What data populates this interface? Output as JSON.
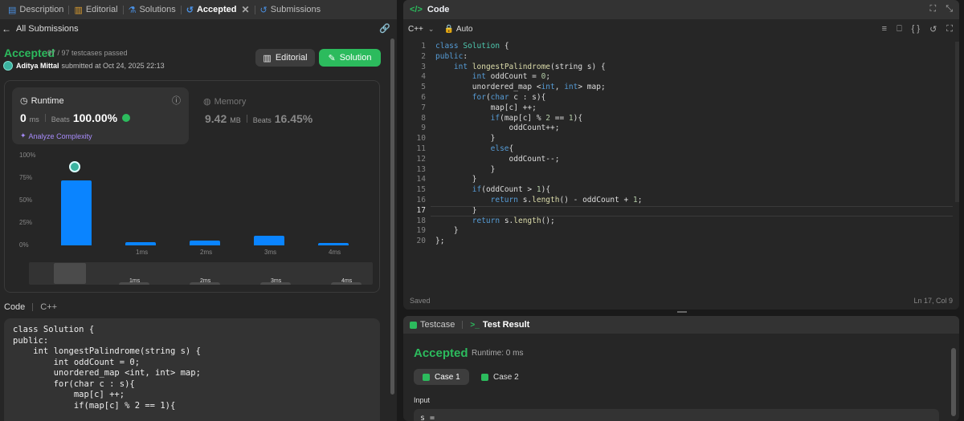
{
  "tabs": [
    {
      "label": "Description",
      "icon": "description-icon"
    },
    {
      "label": "Editorial",
      "icon": "book-icon"
    },
    {
      "label": "Solutions",
      "icon": "flask-icon"
    },
    {
      "label": "Accepted",
      "icon": "history-icon"
    },
    {
      "label": "Submissions",
      "icon": "history-icon"
    }
  ],
  "back_link": "All Submissions",
  "submission": {
    "status": "Accepted",
    "testcases": "97 / 97 testcases passed",
    "user": "Aditya Mittal",
    "submitted_at": "submitted at Oct 24, 2025 22:13",
    "editorial_btn": "Editorial",
    "solution_btn": "Solution"
  },
  "runtime": {
    "title": "Runtime",
    "value": "0",
    "unit": "ms",
    "beats_label": "Beats",
    "beats": "100.00%",
    "analyze": "Analyze Complexity"
  },
  "memory": {
    "title": "Memory",
    "value": "9.42",
    "unit": "MB",
    "beats_label": "Beats",
    "beats": "16.45%"
  },
  "chart_data": {
    "type": "bar",
    "categories": [
      "0ms",
      "1ms",
      "2ms",
      "3ms",
      "4ms"
    ],
    "x_tick_labels": [
      "",
      "1ms",
      "2ms",
      "3ms",
      "4ms"
    ],
    "values": [
      72,
      4,
      5,
      11,
      3
    ],
    "y_ticks": [
      "100%",
      "75%",
      "50%",
      "25%",
      "0%"
    ],
    "ylim": [
      0,
      100
    ],
    "highlight_index": 0,
    "color": "#0a84ff"
  },
  "range_labels": [
    "1ms",
    "2ms",
    "3ms",
    "4ms"
  ],
  "code_section": {
    "label": "Code",
    "lang": "C++",
    "code": "class Solution {\npublic:\n    int longestPalindrome(string s) {\n        int oddCount = 0;\n        unordered_map <int, int> map;\n        for(char c : s){\n            map[c] ++;\n            if(map[c] % 2 == 1){"
  },
  "editor": {
    "title": "Code",
    "language": "C++",
    "mode": "Auto",
    "status": "Saved",
    "cursor": "Ln 17, Col 9",
    "current_line": 17,
    "lines": [
      "class Solution {",
      "public:",
      "    int longestPalindrome(string s) {",
      "        int oddCount = 0;",
      "        unordered_map <int, int> map;",
      "        for(char c : s){",
      "            map[c] ++;",
      "            if(map[c] % 2 == 1){",
      "                oddCount++;",
      "            }",
      "            else{",
      "                oddCount--;",
      "            }",
      "        }",
      "        if(oddCount > 1){",
      "            return s.length() - oddCount + 1;",
      "        }",
      "        return s.length();",
      "    }",
      "};"
    ]
  },
  "result": {
    "tab_testcase": "Testcase",
    "tab_result": "Test Result",
    "status": "Accepted",
    "runtime": "Runtime: 0 ms",
    "case1": "Case 1",
    "case2": "Case 2",
    "input_label": "Input",
    "input_value": "s ="
  },
  "colors": {
    "accent_green": "#2cbb5d",
    "bar_blue": "#0a84ff",
    "bg": "#1a1a1a",
    "panel": "#262626"
  }
}
